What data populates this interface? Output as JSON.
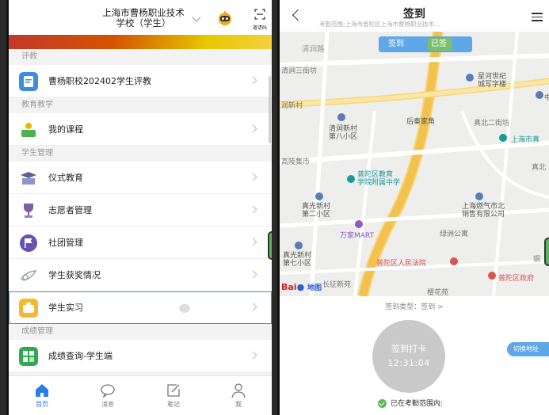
{
  "left": {
    "header": {
      "title_line1": "上海市曹杨职业技术",
      "title_line2": "学校（学生）",
      "scan_label": "邀请码"
    },
    "sections": [
      {
        "title": "评教",
        "items": [
          {
            "label": "曹杨职校202402学生评教",
            "color": "#3b8de0"
          }
        ]
      },
      {
        "title": "教育教学",
        "items": [
          {
            "label": "我的课程",
            "color": "#4caf50"
          }
        ]
      },
      {
        "title": "学生管理",
        "items": [
          {
            "label": "仪式教育",
            "color": "#5b5f97"
          },
          {
            "label": "志愿者管理",
            "color": "#7b5ea7"
          },
          {
            "label": "社团管理",
            "color": "#6a4fb3"
          },
          {
            "label": "学生获奖情况",
            "color": "#9aa0a6"
          },
          {
            "label": "学生实习",
            "color": "#f5b82e"
          }
        ]
      },
      {
        "title": "成绩管理",
        "items": [
          {
            "label": "成绩查询-学生端",
            "color": "#2fa84f"
          }
        ]
      }
    ],
    "tabs": [
      {
        "label": "首页"
      },
      {
        "label": "消息"
      },
      {
        "label": "笔记"
      },
      {
        "label": "我"
      }
    ]
  },
  "right": {
    "header": {
      "title": "签到",
      "subtitle": "考勤范围:上海市普陀区上海市曹杨职业技术..."
    },
    "map": {
      "pill_left": "签到",
      "pill_right": "已签",
      "labels": {
        "qinghe_road": "清涧路",
        "qinghe_3rd": "清涧三街坊",
        "qinghe_new": "润新村",
        "houqin": "后秦家角",
        "zhenbei": "真北二街坊",
        "xingguang": "星河世纪\n城写字楼",
        "qinghe_new8": "清涧新村\n第八小区",
        "shanghai_east": "上海市真",
        "gaoling": "高陵集市",
        "zhen": "真北",
        "putuo_edu": "普陀区教育\n学院附属中学",
        "zhenguang2": "真光新村\n第二小区",
        "gas_north": "上海燃气市北\n销售有限公司",
        "wanjia": "万家MART",
        "lvzhou": "绿洲公寓",
        "zhenguang7": "真光新村\n第七小区",
        "court": "普陀区人民法院",
        "tong": "铜",
        "gov": "普陀区政府",
        "changzheng": "长征新苑",
        "yinghua": "樱花苑",
        "zhong": "中"
      },
      "baidu_a": "Bai",
      "baidu_b": "地图"
    },
    "sign_type": "签到类型：签到 >",
    "button": {
      "label": "签到打卡",
      "time": "12:31:04"
    },
    "switch_label": "切换地址",
    "in_range": "已在考勤范围内:"
  }
}
